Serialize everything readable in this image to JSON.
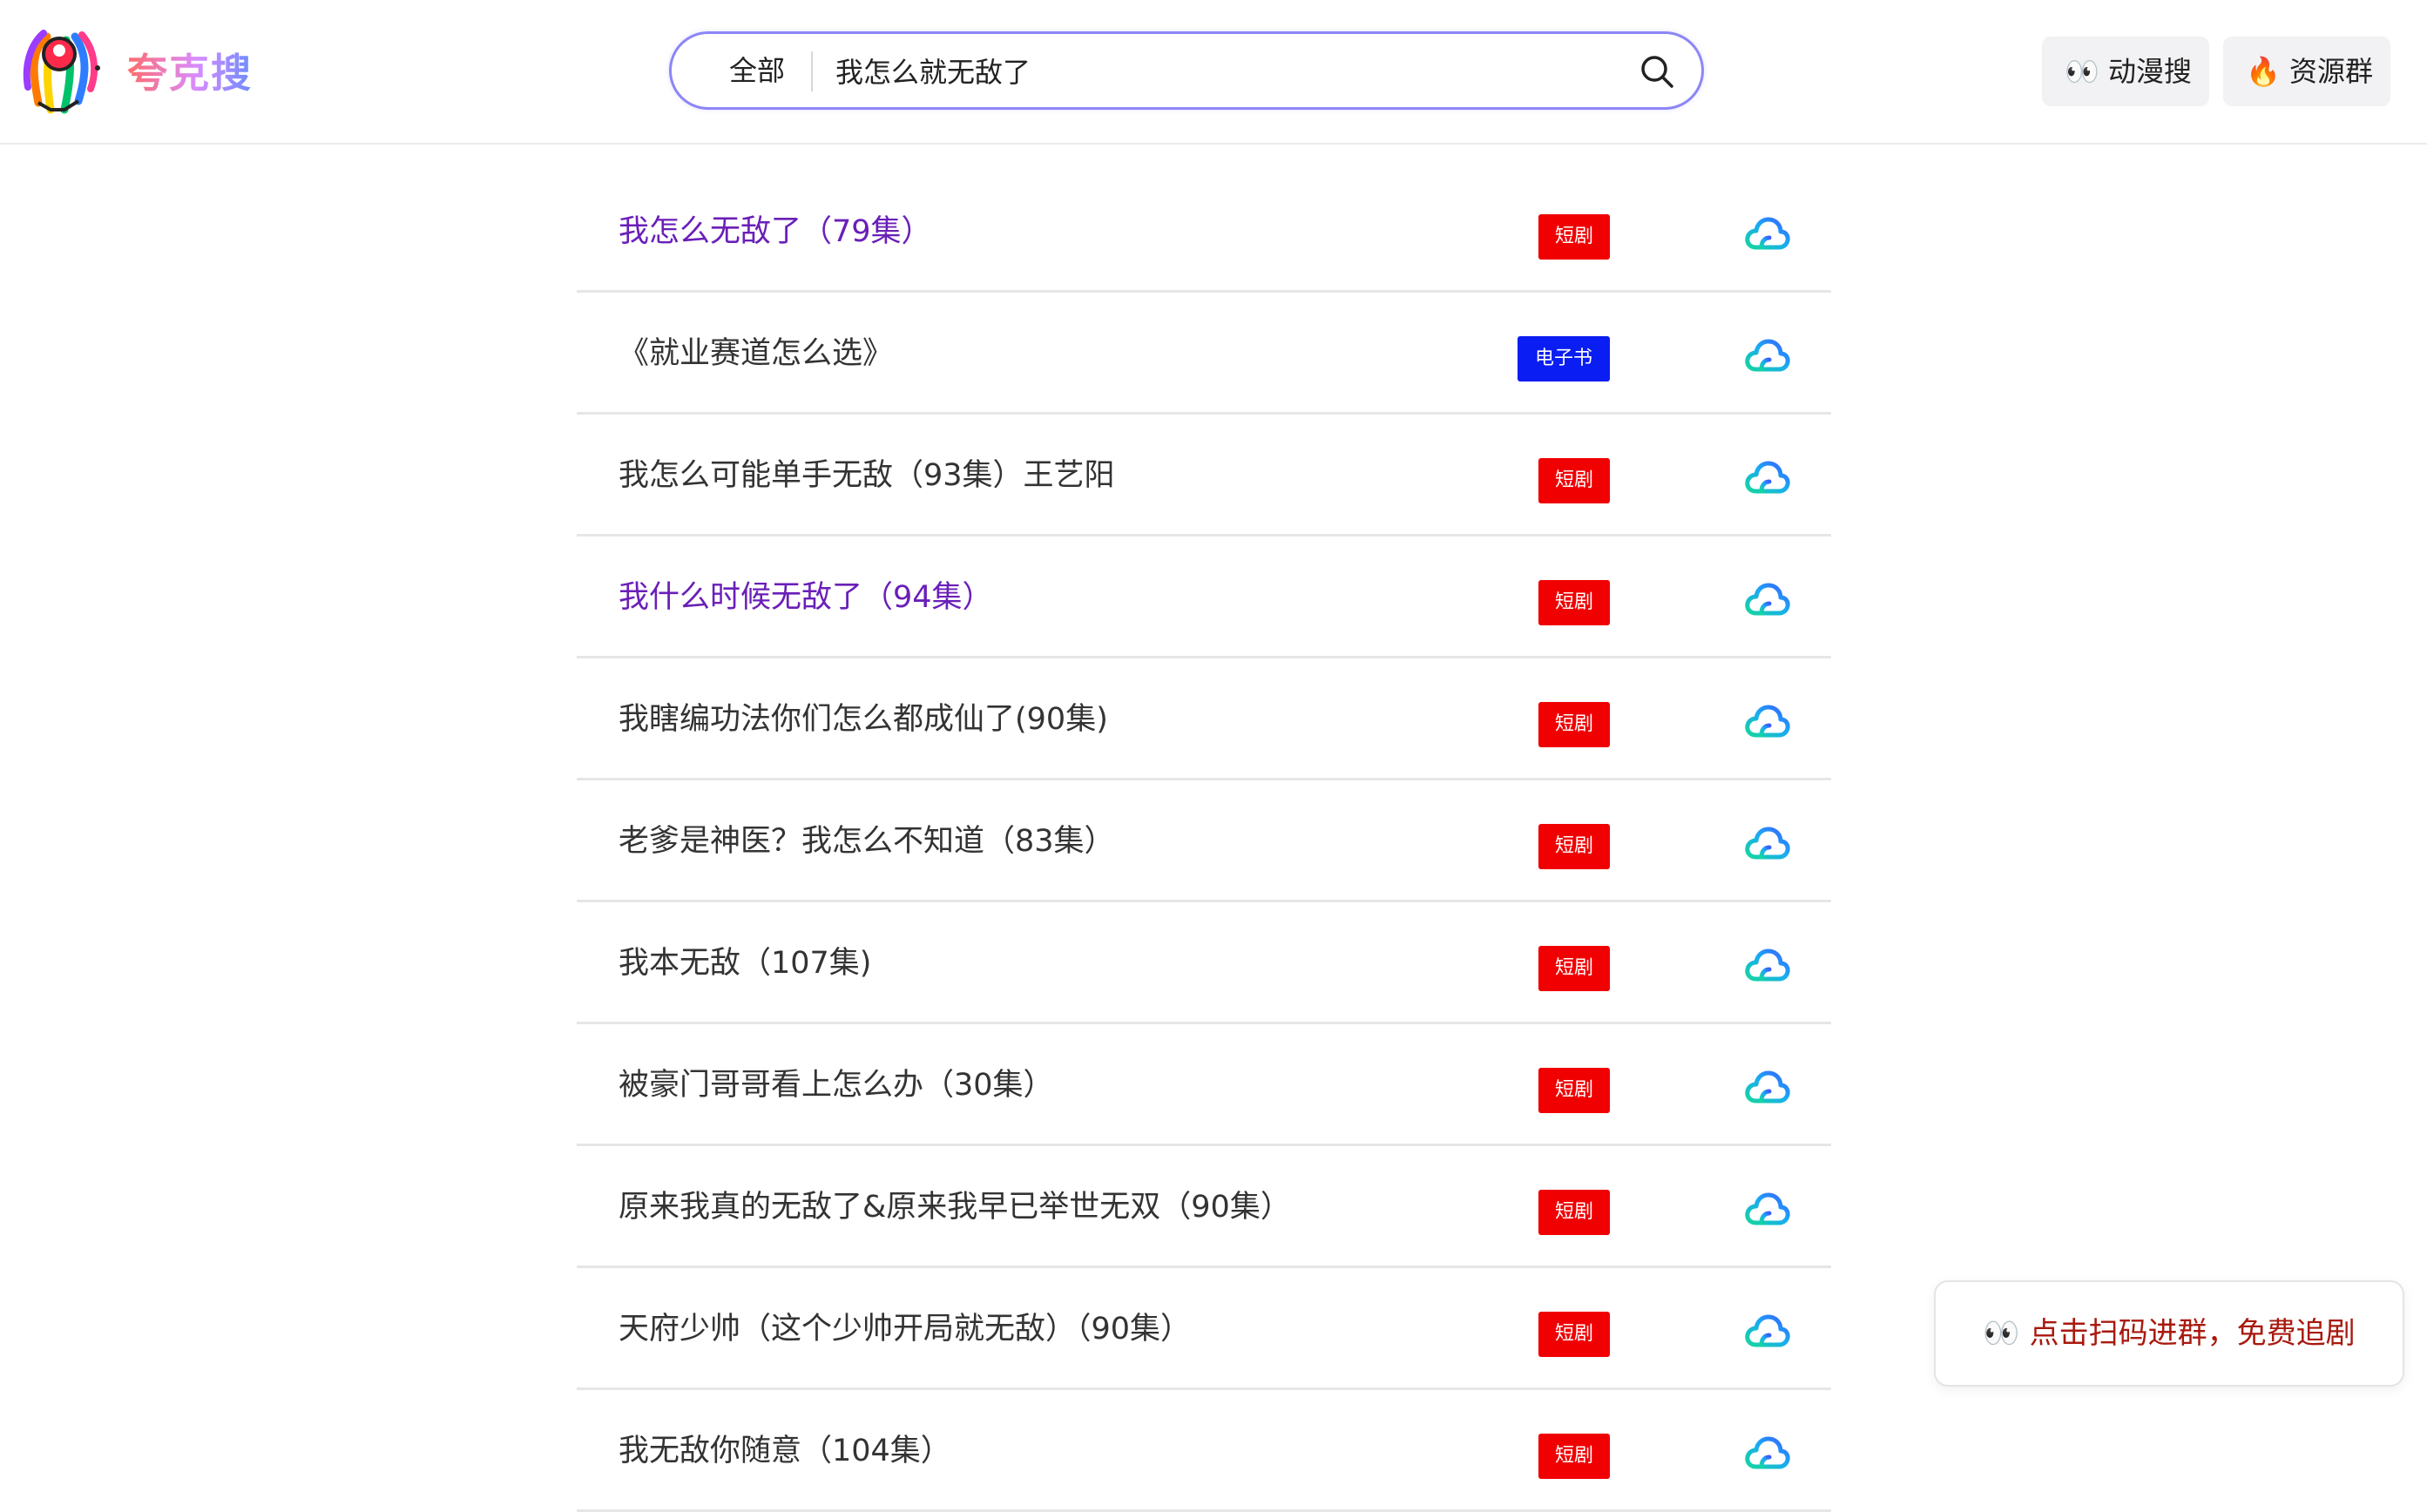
{
  "header": {
    "brand": "夸克搜",
    "search": {
      "scope": "全部",
      "query": "我怎么就无敌了"
    },
    "buttons": [
      {
        "label": "👀 动漫搜"
      },
      {
        "label": "🔥 资源群"
      }
    ]
  },
  "results": [
    {
      "title": "我怎么无敌了（79集）",
      "tag": "短剧",
      "visited": true
    },
    {
      "title": "《就业赛道怎么选》",
      "tag": "电子书",
      "visited": false
    },
    {
      "title": "我怎么可能单手无敌（93集）王艺阳",
      "tag": "短剧",
      "visited": false
    },
    {
      "title": "我什么时候无敌了（94集）",
      "tag": "短剧",
      "visited": true
    },
    {
      "title": "我瞎编功法你们怎么都成仙了(90集)",
      "tag": "短剧",
      "visited": false
    },
    {
      "title": "老爹是神医？我怎么不知道（83集）",
      "tag": "短剧",
      "visited": false
    },
    {
      "title": "我本无敌（107集)",
      "tag": "短剧",
      "visited": false
    },
    {
      "title": "被豪门哥哥看上怎么办（30集）",
      "tag": "短剧",
      "visited": false
    },
    {
      "title": "原来我真的无敌了&原来我早已举世无双（90集）",
      "tag": "短剧",
      "visited": false
    },
    {
      "title": "天府少帅（这个少帅开局就无敌）（90集）",
      "tag": "短剧",
      "visited": false
    },
    {
      "title": "我无敌你随意（104集）",
      "tag": "短剧",
      "visited": false
    }
  ],
  "popup": {
    "text": "👀 点击扫码进群，免费追剧"
  },
  "colors": {
    "tag_drama": "#f00000",
    "tag_ebook": "#0a1df2",
    "visited_link": "#6a1fb8",
    "search_border": "#8d86f7",
    "popup_text": "#a8190e"
  },
  "icons": {
    "logo": "quark-logo-icon",
    "search": "search-icon",
    "result": "cloud-download-icon"
  }
}
